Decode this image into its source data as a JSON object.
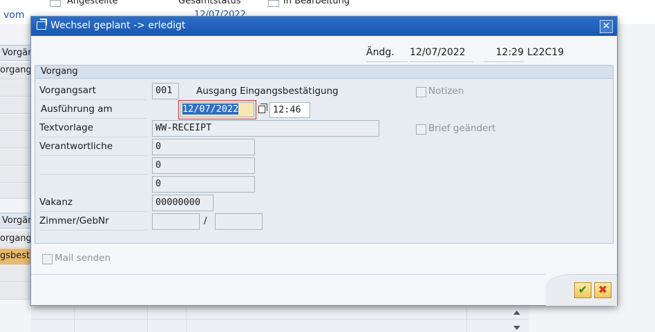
{
  "background": {
    "top_labels": [
      "Angestellte",
      "Gesamtstatus",
      "In Bearbeitung"
    ],
    "vom_label": "vom",
    "vom_date": "12/07/2022",
    "group_header_1": "Vorgän",
    "row_1": "organg",
    "group_header_2": "Vorgän",
    "row_2": "organg",
    "row_3_highlight": "gsbest."
  },
  "dialog": {
    "title": "Wechsel geplant -> erledigt",
    "header": {
      "changed_label": "Ändg.",
      "changed_date": "12/07/2022",
      "changed_time": "12:29",
      "changed_user": "L22C19"
    },
    "group": {
      "title": "Vorgang",
      "vorgangsart_label": "Vorgangsart",
      "vorgangsart_value": "001",
      "vorgangsart_text": "Ausgang Eingangsbestätigung",
      "ausfuehrung_label": "Ausführung am",
      "ausfuehrung_date": "12/07/2022",
      "ausfuehrung_time": "12:46",
      "textvorlage_label": "Textvorlage",
      "textvorlage_value": "WW-RECEIPT",
      "verantwortliche_label": "Verantwortliche",
      "verantwortliche_values": [
        "0",
        "0",
        "0"
      ],
      "vakanz_label": "Vakanz",
      "vakanz_value": "00000000",
      "zimmer_label": "Zimmer/GebNr",
      "zimmer_value": "",
      "zimmer_separator": "/",
      "gebnr_value": "",
      "notizen_label": "Notizen",
      "brief_label": "Brief geändert"
    },
    "mail_label": "Mail senden",
    "buttons": {
      "ok_icon": "check-icon",
      "cancel_icon": "cancel-icon"
    }
  },
  "colors": {
    "titlebar": "#1f5fb8",
    "highlight_date": "#2f6fc6",
    "orange_row": "#e7b96c"
  }
}
